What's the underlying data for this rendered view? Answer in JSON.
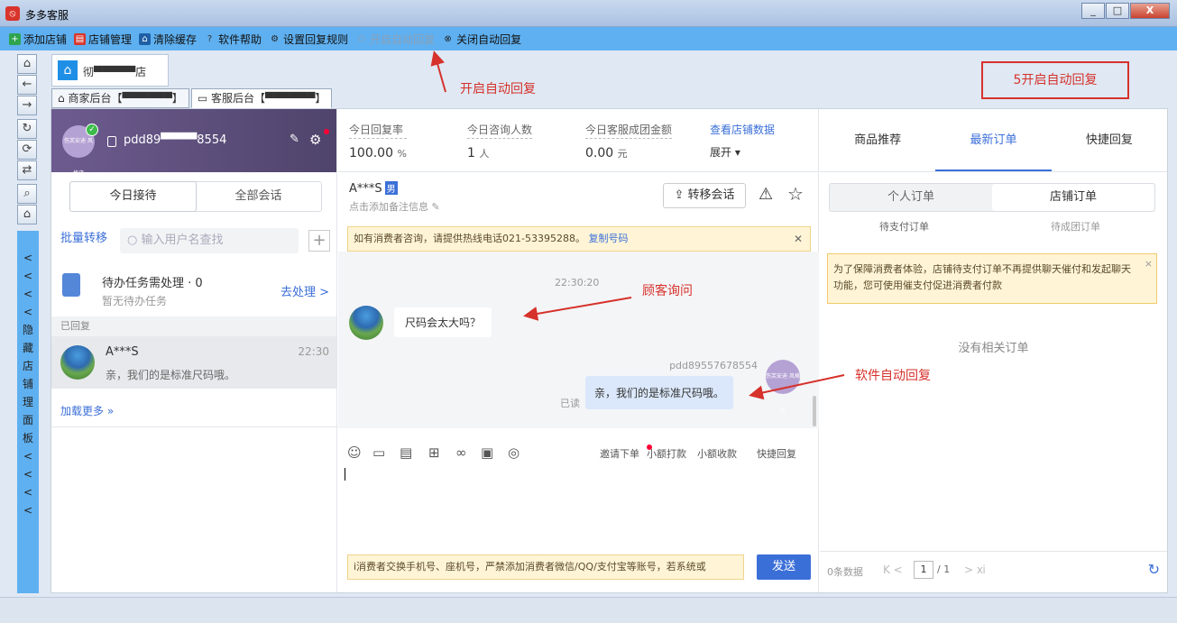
{
  "window": {
    "title": "多多客服",
    "min": "_",
    "max": "□",
    "close": "X"
  },
  "menu": [
    {
      "label": "添加店铺",
      "icon": "plus-icon",
      "color": "#2ea44f"
    },
    {
      "label": "店铺管理",
      "icon": "store-icon",
      "color": "#d9342b"
    },
    {
      "label": "清除缓存",
      "icon": "broom-icon",
      "color": "#1f5fa6"
    },
    {
      "label": "软件帮助",
      "icon": "help-icon",
      "color": "#333333"
    },
    {
      "label": "设置回复规则",
      "icon": "gear-icon",
      "color": "#333333"
    },
    {
      "label": "开启自动回复",
      "icon": "power-icon",
      "color": "#8aa0b8"
    },
    {
      "label": "关闭自动回复",
      "icon": "close-circle-icon",
      "color": "#333333"
    }
  ],
  "sidebar": {
    "hide_label": "隐藏店铺理面板"
  },
  "store": {
    "tab_name": "彻▀▀▀▀▀店",
    "subtabs": [
      "商家后台【▀▀▀▀▀▀】",
      "客服后台【▀▀▀▀▀▀】"
    ]
  },
  "annotations": {
    "open_auto": "开启自动回复",
    "step5": "5开启自动回复",
    "customer_ask": "顾客询问",
    "auto_reply": "软件自动回复"
  },
  "account": {
    "name": "pdd89▀▀▀▀8554",
    "avatar_text": "伤芙安迪 风格店"
  },
  "conv_tabs": {
    "today": "今日接待",
    "all": "全部会话"
  },
  "search": {
    "batch": "批量转移",
    "placeholder": "输入用户名查找",
    "plus": "+"
  },
  "todo": {
    "title": "待办任务需处理 · 0",
    "sub": "暂无待办任务",
    "action": "去处理 >"
  },
  "replied_header": "已回复",
  "session": {
    "name": "A***S",
    "time": "22:30",
    "msg": "亲，我们的是标准尺码哦。"
  },
  "load_more": "加载更多 »",
  "stats": {
    "reply_rate_label": "今日回复率",
    "reply_rate": "100.00",
    "reply_rate_unit": "%",
    "consult_label": "今日咨询人数",
    "consult": "1",
    "consult_unit": "人",
    "amount_label": "今日客服成团金额",
    "amount": "0.00",
    "amount_unit": "元",
    "store_data_link": "查看店铺数据",
    "expand": "展开 ▾"
  },
  "chat": {
    "customer": "A***S",
    "gender": "男",
    "note": "点击添加备注信息",
    "transfer": "转移会话",
    "notice": "如有消费者咨询，请提供热线电话021-53395288。",
    "copy": "复制号码",
    "time": "22:30:20",
    "customer_msg": "尺码会太大吗？",
    "sender": "pdd89557678554",
    "read": "已读",
    "reply_msg": "亲，我们的是标准尺码哦。",
    "agent_avatar": "伤芙安迪 风格店",
    "actions": [
      "邀请下单",
      "小额打款",
      "小额收款",
      "快捷回复"
    ],
    "input_hint": "i消费者交换手机号、座机号，严禁添加消费者微信/QQ/支付宝等账号，若系统或",
    "send": "发送"
  },
  "right": {
    "tabs": [
      "商品推荐",
      "最新订单",
      "快捷回复"
    ],
    "order_seg": [
      "个人订单",
      "店铺订单"
    ],
    "sub1": "待支付订单",
    "sub2": "待成团订单",
    "tip": "为了保障消费者体验，店铺待支付订单不再提供聊天催付和发起聊天功能，您可使用催支付促进消费者付款",
    "empty": "没有相关订单",
    "count": "0条数据",
    "page": "1",
    "total": "/ 1"
  }
}
